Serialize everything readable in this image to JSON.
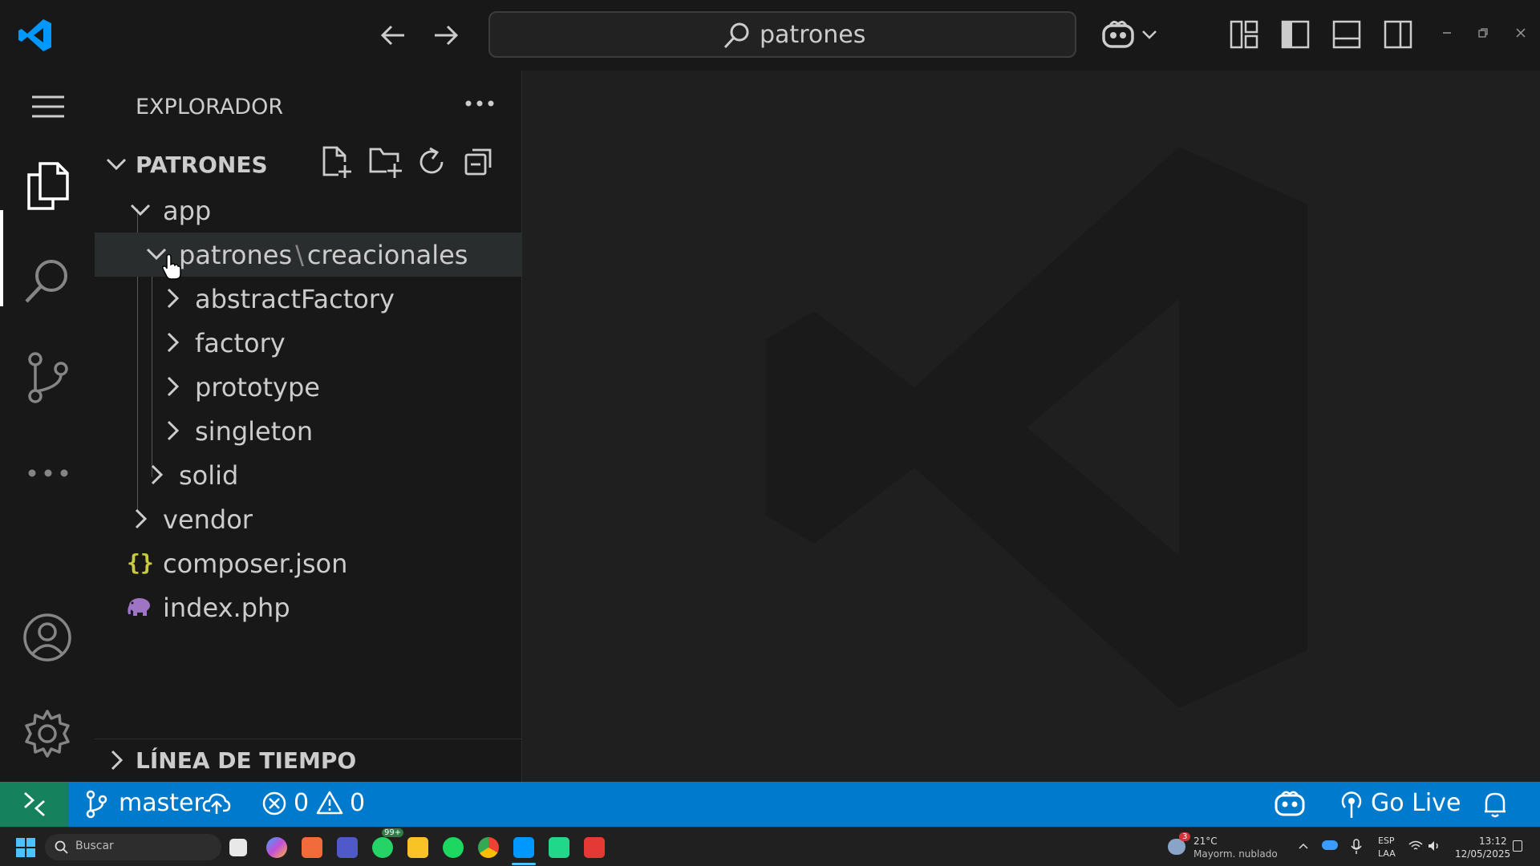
{
  "titlebar": {
    "search_text": "patrones"
  },
  "sidebar": {
    "title": "EXPLORADOR",
    "folder_name": "PATRONES",
    "tree": [
      {
        "label": "app"
      },
      {
        "label": "patrones"
      },
      {
        "label_suffix": "creacionales"
      },
      {
        "label": "abstractFactory"
      },
      {
        "label": "factory"
      },
      {
        "label": "prototype"
      },
      {
        "label": "singleton"
      },
      {
        "label": "solid"
      },
      {
        "label": "vendor"
      },
      {
        "label": "composer.json"
      },
      {
        "label": "index.php"
      }
    ],
    "compact_separator": "\\",
    "timeline_label": "LÍNEA DE TIEMPO"
  },
  "statusbar": {
    "branch": "master",
    "errors": "0",
    "warnings": "0",
    "go_live": "Go Live"
  },
  "taskbar": {
    "search_placeholder": "Buscar",
    "whatsapp_badge": "99+",
    "weather_badge": "3",
    "temperature": "21°C",
    "weather_desc": "Mayorm. nublado",
    "lang_top": "ESP",
    "lang_bottom": "LAA",
    "time": "13:12",
    "date": "12/05/2025"
  },
  "colors": {
    "statusbar_bg": "#007acc",
    "remote_bg": "#16825d",
    "json_icon": "#cbcb41",
    "php_icon": "#a074c4",
    "vscode_blue": "#0098ff"
  }
}
